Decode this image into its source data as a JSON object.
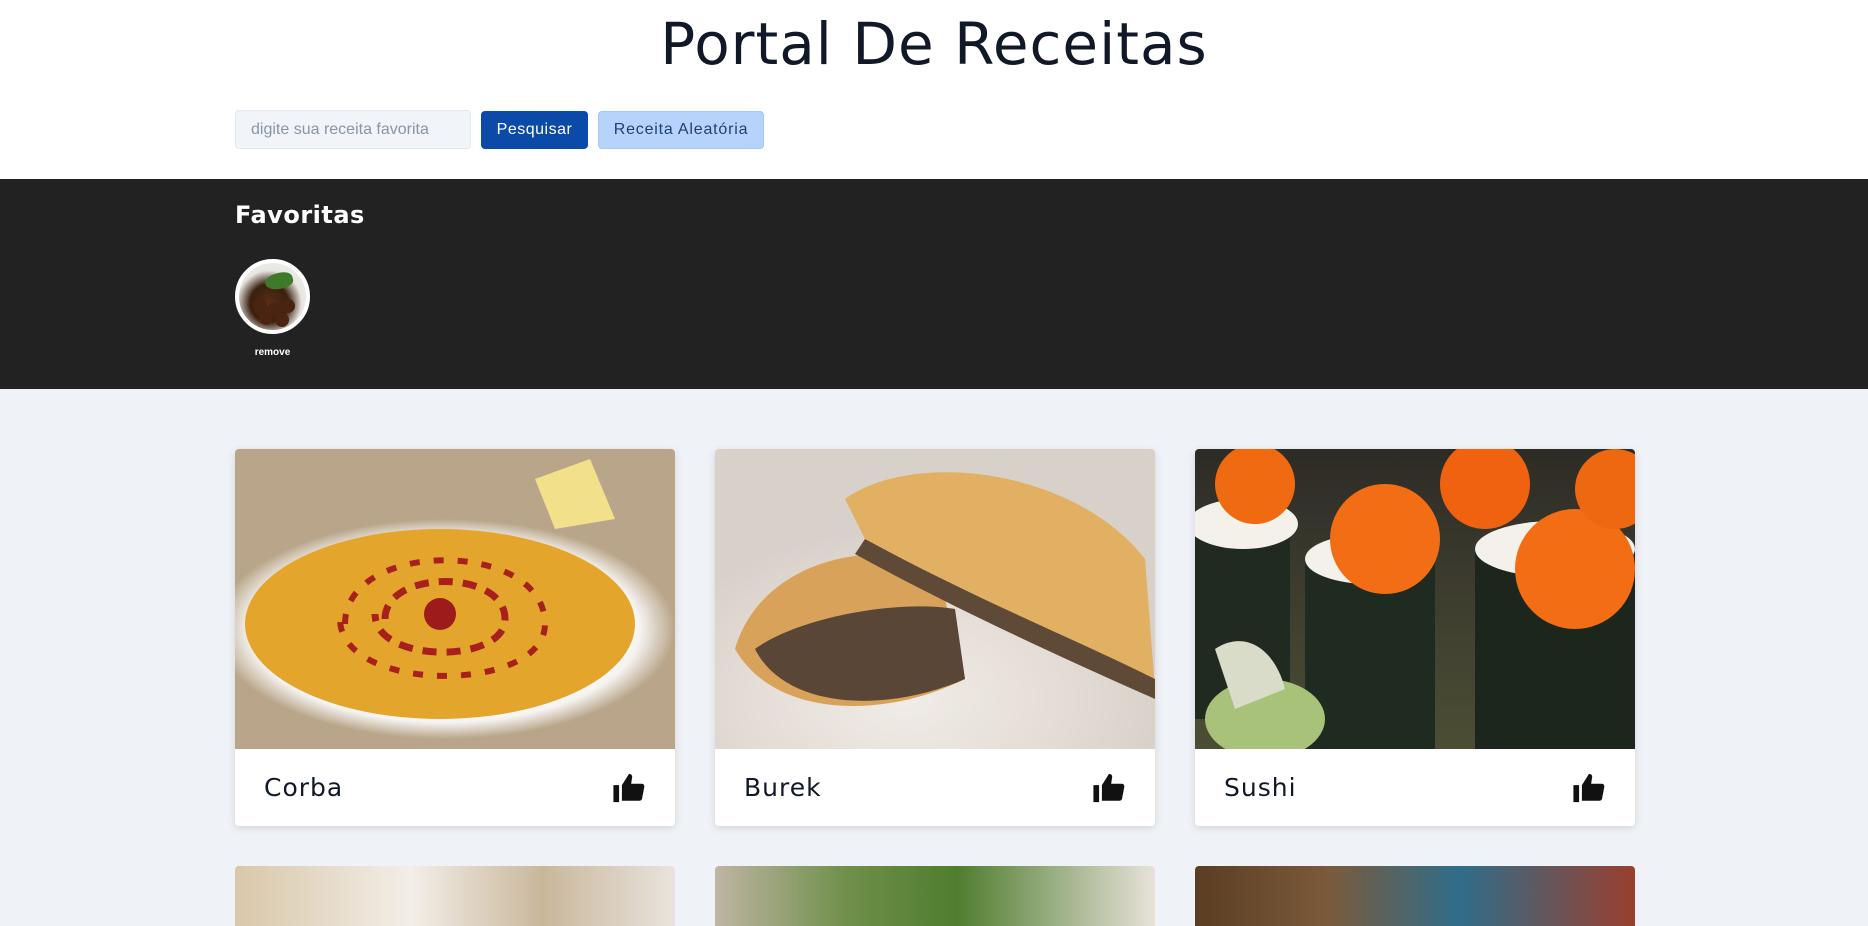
{
  "header": {
    "title": "Portal De Receitas",
    "search_placeholder": "digite sua receita favorita",
    "search_button": "Pesquisar",
    "random_button": "Receita Aleatória"
  },
  "favorites": {
    "title": "Favoritas",
    "items": [
      {
        "remove_label": "remove"
      }
    ]
  },
  "recipes": [
    {
      "name": "Corba",
      "icon": "thumbs-up-icon"
    },
    {
      "name": "Burek",
      "icon": "thumbs-up-icon"
    },
    {
      "name": "Sushi",
      "icon": "thumbs-up-icon"
    }
  ]
}
